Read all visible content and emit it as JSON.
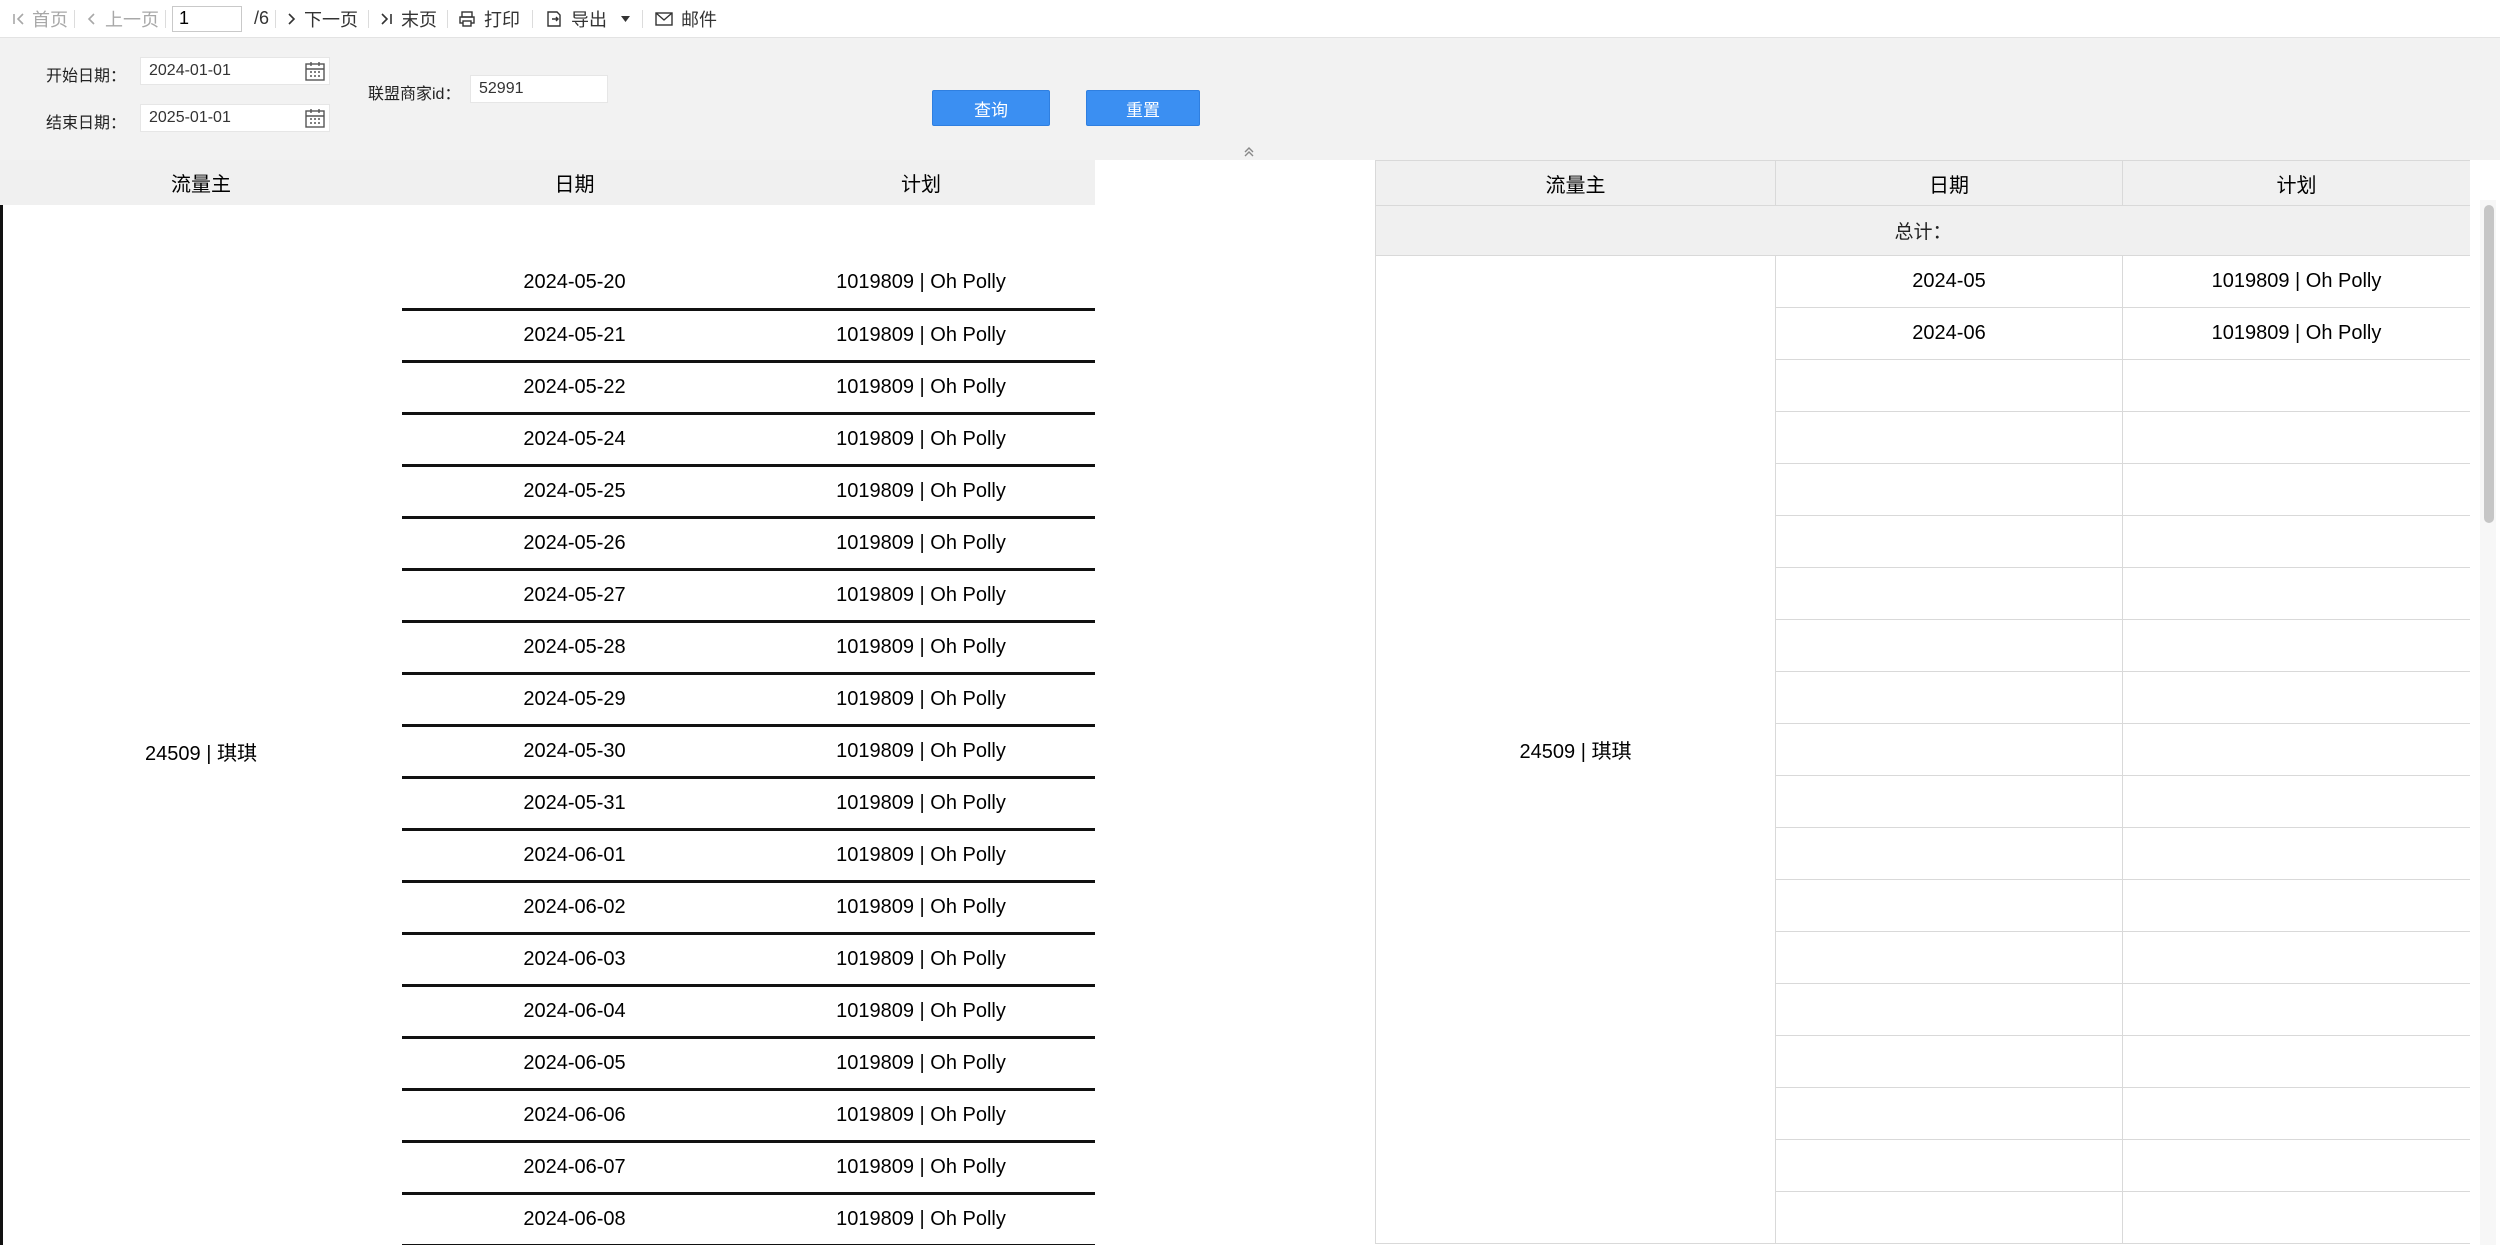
{
  "toolbar": {
    "first_label": "首页",
    "prev_label": "上一页",
    "page_value": "1",
    "page_total": "/6",
    "next_label": "下一页",
    "last_label": "末页",
    "print_label": "打印",
    "export_label": "导出",
    "mail_label": "邮件"
  },
  "filter": {
    "start_label": "开始日期：",
    "start_value": "2024-01-01",
    "end_label": "结束日期：",
    "end_value": "2025-01-01",
    "merchant_label": "联盟商家id：",
    "merchant_value": "52991",
    "query_label": "查询",
    "reset_label": "重置"
  },
  "left_table": {
    "headers": [
      "流量主",
      "日期",
      "计划"
    ],
    "publisher": "24509 | 琪琪",
    "rows": [
      {
        "date": "2024-05-20",
        "plan": "1019809 | Oh Polly"
      },
      {
        "date": "2024-05-21",
        "plan": "1019809 | Oh Polly"
      },
      {
        "date": "2024-05-22",
        "plan": "1019809 | Oh Polly"
      },
      {
        "date": "2024-05-24",
        "plan": "1019809 | Oh Polly"
      },
      {
        "date": "2024-05-25",
        "plan": "1019809 | Oh Polly"
      },
      {
        "date": "2024-05-26",
        "plan": "1019809 | Oh Polly"
      },
      {
        "date": "2024-05-27",
        "plan": "1019809 | Oh Polly"
      },
      {
        "date": "2024-05-28",
        "plan": "1019809 | Oh Polly"
      },
      {
        "date": "2024-05-29",
        "plan": "1019809 | Oh Polly"
      },
      {
        "date": "2024-05-30",
        "plan": "1019809 | Oh Polly"
      },
      {
        "date": "2024-05-31",
        "plan": "1019809 | Oh Polly"
      },
      {
        "date": "2024-06-01",
        "plan": "1019809 | Oh Polly"
      },
      {
        "date": "2024-06-02",
        "plan": "1019809 | Oh Polly"
      },
      {
        "date": "2024-06-03",
        "plan": "1019809 | Oh Polly"
      },
      {
        "date": "2024-06-04",
        "plan": "1019809 | Oh Polly"
      },
      {
        "date": "2024-06-05",
        "plan": "1019809 | Oh Polly"
      },
      {
        "date": "2024-06-06",
        "plan": "1019809 | Oh Polly"
      },
      {
        "date": "2024-06-07",
        "plan": "1019809 | Oh Polly"
      },
      {
        "date": "2024-06-08",
        "plan": "1019809 | Oh Polly"
      }
    ]
  },
  "right_table": {
    "headers": [
      "流量主",
      "日期",
      "计划"
    ],
    "total_label": "总计：",
    "publisher": "24509 | 琪琪",
    "rows": [
      {
        "date": "2024-05",
        "plan": "1019809 | Oh Polly"
      },
      {
        "date": "2024-06",
        "plan": "1019809 | Oh Polly"
      },
      {
        "date": "",
        "plan": ""
      },
      {
        "date": "",
        "plan": ""
      },
      {
        "date": "",
        "plan": ""
      },
      {
        "date": "",
        "plan": ""
      },
      {
        "date": "",
        "plan": ""
      },
      {
        "date": "",
        "plan": ""
      },
      {
        "date": "",
        "plan": ""
      },
      {
        "date": "",
        "plan": ""
      },
      {
        "date": "",
        "plan": ""
      },
      {
        "date": "",
        "plan": ""
      },
      {
        "date": "",
        "plan": ""
      },
      {
        "date": "",
        "plan": ""
      },
      {
        "date": "",
        "plan": ""
      },
      {
        "date": "",
        "plan": ""
      },
      {
        "date": "",
        "plan": ""
      },
      {
        "date": "",
        "plan": ""
      },
      {
        "date": "",
        "plan": ""
      }
    ]
  },
  "colors": {
    "accent": "#3b8ff2",
    "panel": "#f2f2f2",
    "header": "#f0f0f0"
  }
}
